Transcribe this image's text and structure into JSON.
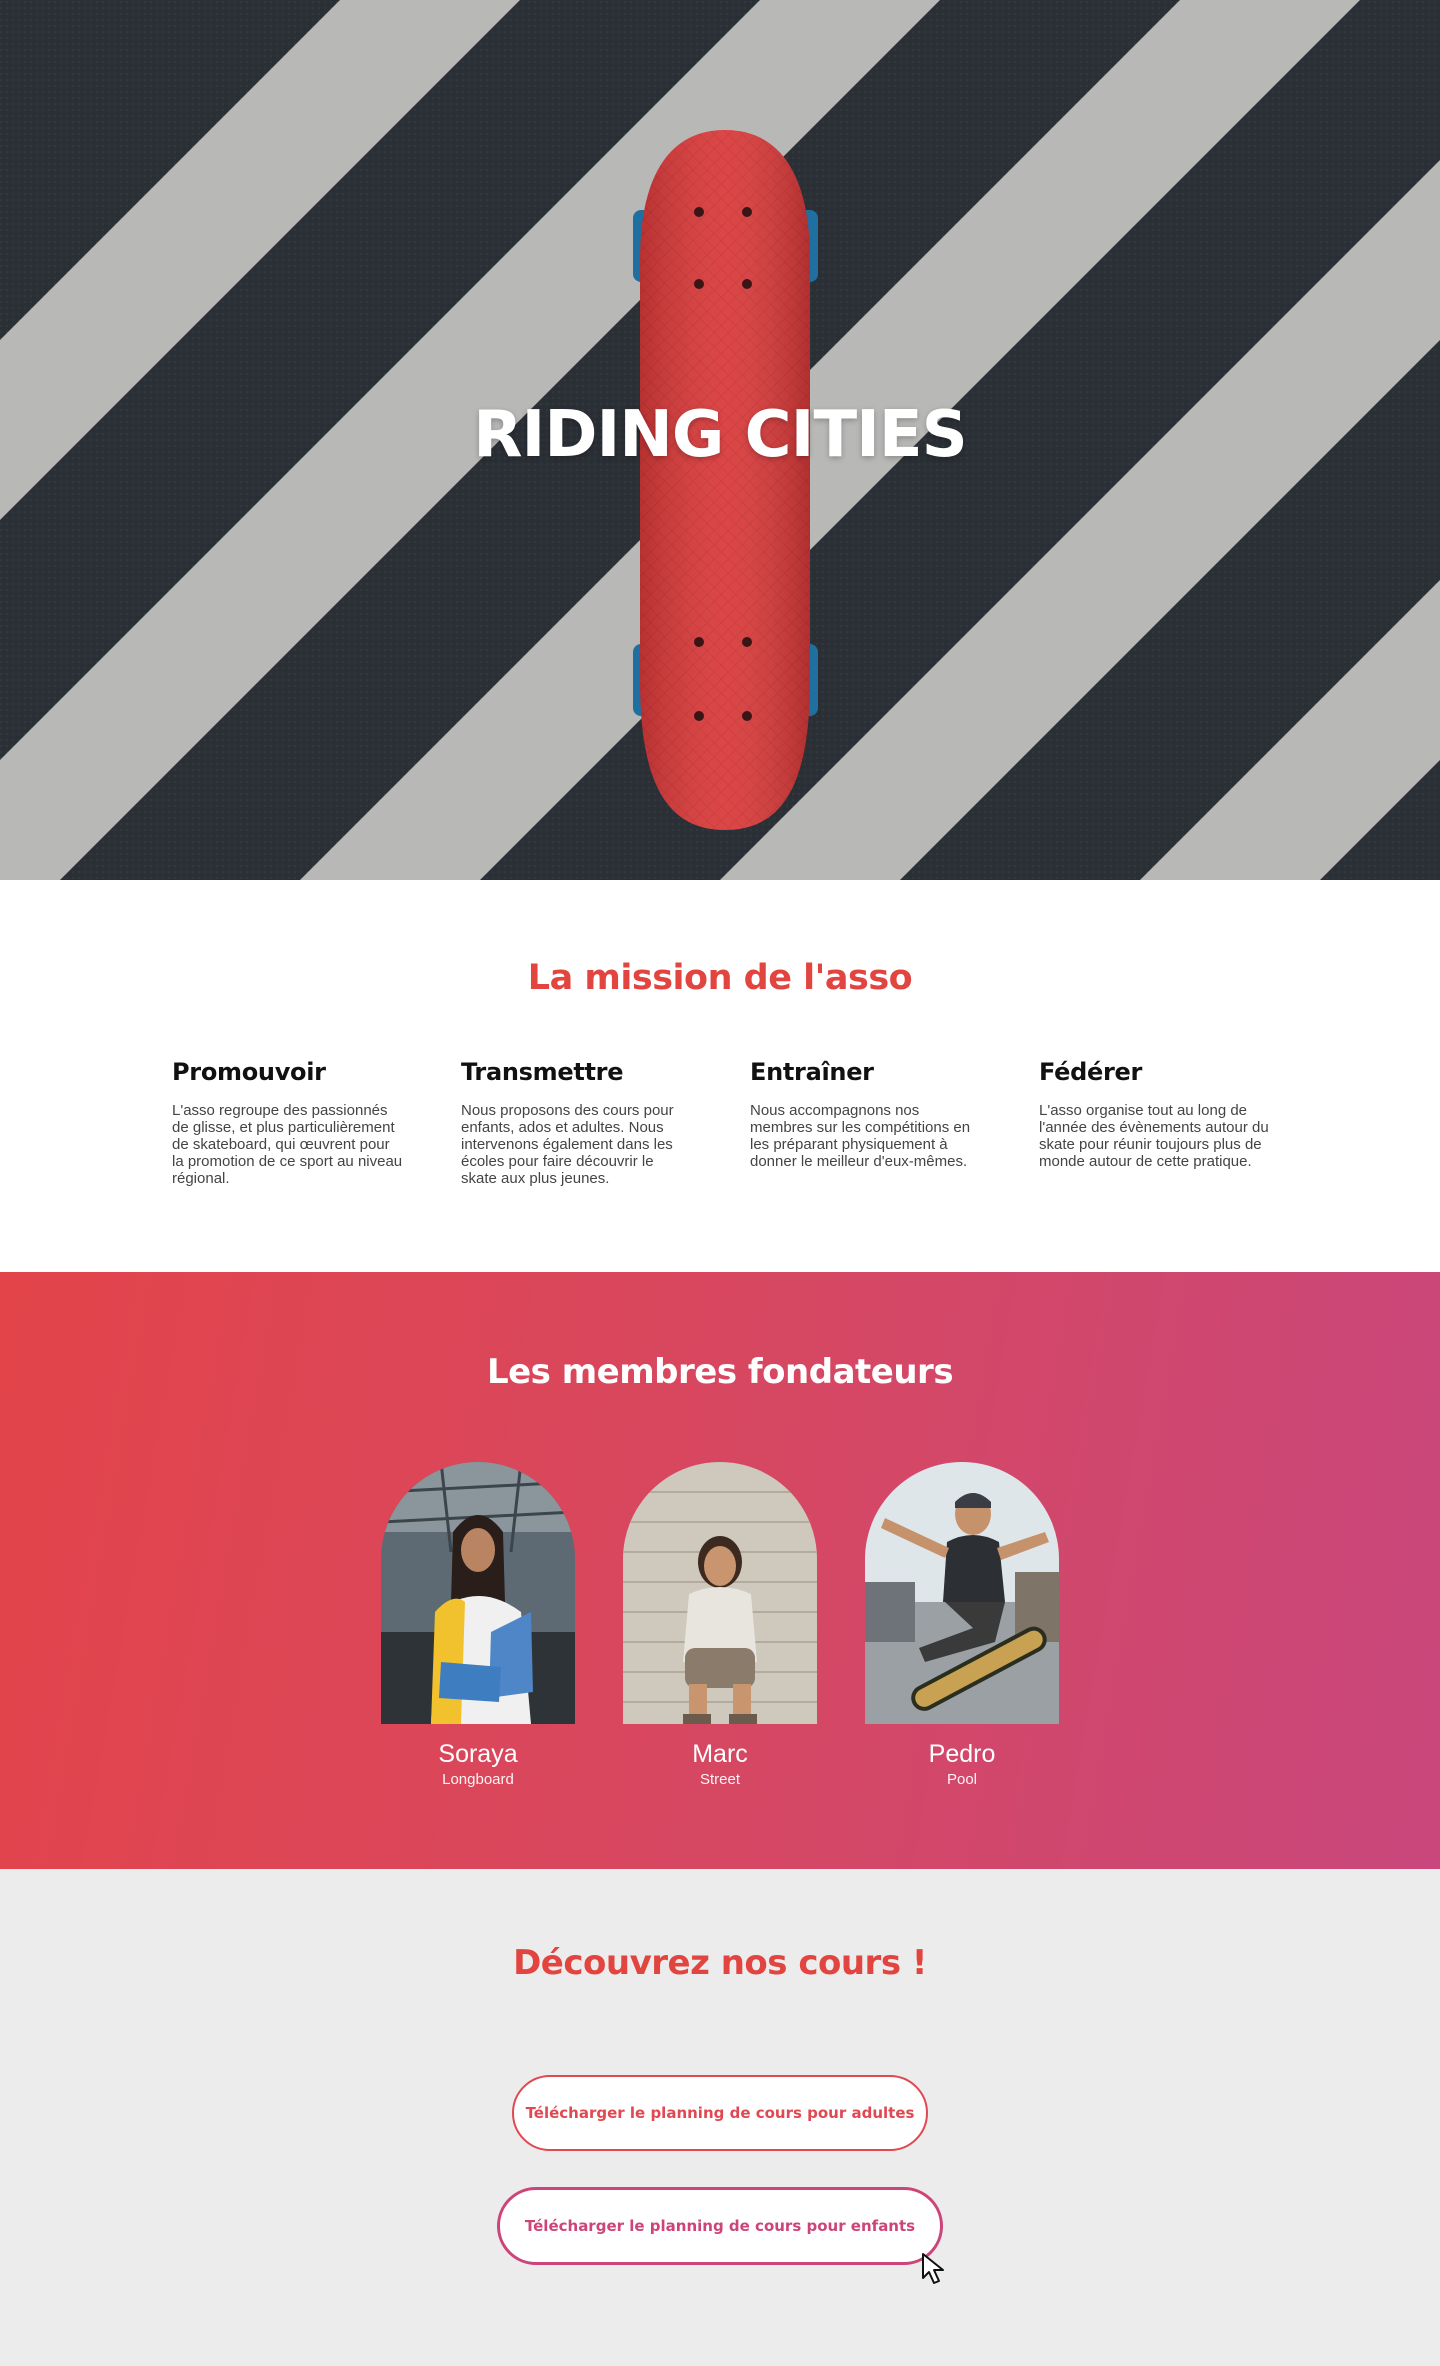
{
  "hero": {
    "title": "RIDING CITIES"
  },
  "mission": {
    "title": "La mission de l'asso",
    "pillars": [
      {
        "title": "Promouvoir",
        "text": "L'asso regroupe des passionnés de glisse, et plus particulièrement de skateboard, qui œuvrent pour la promotion de ce sport au niveau régional."
      },
      {
        "title": "Transmettre",
        "text": "Nous proposons des cours pour enfants, ados et adultes. Nous intervenons également dans les écoles pour faire découvrir le skate aux plus jeunes."
      },
      {
        "title": "Entraîner",
        "text": "Nous accompagnons nos membres sur les compétitions en les préparant physiquement à donner le meilleur d'eux-mêmes."
      },
      {
        "title": "Fédérer",
        "text": "L'asso organise tout au long de l'année des évènements autour du skate pour réunir toujours plus de monde autour de cette pratique."
      }
    ]
  },
  "members": {
    "title": "Les membres fondateurs",
    "list": [
      {
        "name": "Soraya",
        "role": "Longboard"
      },
      {
        "name": "Marc",
        "role": "Street"
      },
      {
        "name": "Pedro",
        "role": "Pool"
      }
    ]
  },
  "courses": {
    "title": "Découvrez nos cours !",
    "adults_button": "Télécharger le planning de cours pour adultes",
    "kids_button": "Télécharger le planning de cours pour enfants"
  },
  "colors": {
    "accent_red": "#e2453f",
    "gradient_start": "#e3444a",
    "gradient_end": "#c9477c",
    "kids_button": "#cc4478",
    "courses_bg": "#ececec"
  },
  "icons": [
    "mouse-pointer-icon"
  ]
}
